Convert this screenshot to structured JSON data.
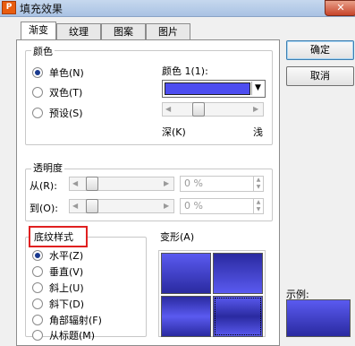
{
  "window": {
    "title": "填充效果",
    "app_icon": "P"
  },
  "tabs": [
    {
      "label": "渐变",
      "active": true
    },
    {
      "label": "纹理"
    },
    {
      "label": "图案"
    },
    {
      "label": "图片"
    }
  ],
  "color_group": {
    "title": "颜色",
    "options": [
      {
        "label": "单色(N)",
        "selected": true
      },
      {
        "label": "双色(T)"
      },
      {
        "label": "预设(S)"
      }
    ],
    "color1_label": "颜色 1(1):",
    "color1_value": "#4d4df0",
    "dark_label": "深(K)",
    "light_label": "浅"
  },
  "transparency": {
    "title": "透明度",
    "from_label": "从(R):",
    "to_label": "到(O):",
    "from_value": "0 %",
    "to_value": "0 %"
  },
  "shading": {
    "title": "底纹样式",
    "options": [
      {
        "label": "水平(Z)",
        "selected": true
      },
      {
        "label": "垂直(V)"
      },
      {
        "label": "斜上(U)"
      },
      {
        "label": "斜下(D)"
      },
      {
        "label": "角部辐射(F)"
      },
      {
        "label": "从标题(M)"
      }
    ]
  },
  "variants": {
    "title": "变形(A)"
  },
  "sample": {
    "title": "示例:"
  },
  "buttons": {
    "ok": "确定",
    "cancel": "取消"
  },
  "colors": {
    "gradient_dark": "#2a2aa0",
    "gradient_light": "#5a5af0",
    "highlight": "#e02020"
  }
}
